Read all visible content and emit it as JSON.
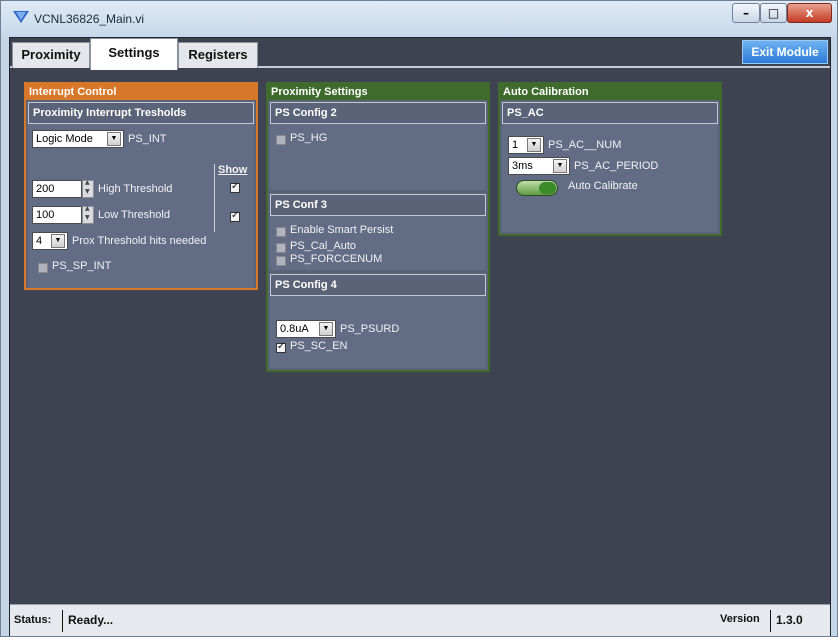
{
  "window": {
    "title": "VCNL36826_Main.vi",
    "minimize": "–",
    "maximize": "□",
    "close": "x"
  },
  "tabs": [
    {
      "label": "Proximity"
    },
    {
      "label": "Settings"
    },
    {
      "label": "Registers"
    }
  ],
  "exit_button": "Exit Module",
  "interrupt_control": {
    "title": "Interrupt Control",
    "group_title": "Proximity Interrupt Tresholds",
    "logic_mode": "Logic Mode",
    "ps_int_label": "PS_INT",
    "show_label": "Show",
    "high_value": "200",
    "high_label": "High Threshold",
    "low_value": "100",
    "low_label": "Low Threshold",
    "hits_value": "4",
    "hits_label": "Prox Threshold hits needed",
    "sp_int_label": "PS_SP_INT"
  },
  "proximity_settings": {
    "title": "Proximity  Settings",
    "config2_title": "PS Config 2",
    "ps_hg": "PS_HG",
    "conf3_title": "PS Conf 3",
    "smart_persist": "Enable Smart Persist",
    "cal_auto": "PS_Cal_Auto",
    "forccenum": "PS_FORCCENUM",
    "config4_title": "PS Config 4",
    "psurd_value": "0.8uA",
    "psurd_label": "PS_PSURD",
    "sc_en_label": "PS_SC_EN"
  },
  "auto_calibration": {
    "title": "Auto Calibration",
    "group_title": "PS_AC",
    "num_value": "1",
    "num_label": "PS_AC__NUM",
    "period_value": "3ms",
    "period_label": "PS_AC_PERIOD",
    "button_label": "Auto Calibrate"
  },
  "status": {
    "label": "Status:",
    "value": "Ready...",
    "version_label": "Version",
    "version_value": "1.3.0"
  },
  "colors": {
    "orange": "#d8772a",
    "green": "#3f6b2c",
    "panel": "#626c85",
    "background": "#3d4350"
  }
}
